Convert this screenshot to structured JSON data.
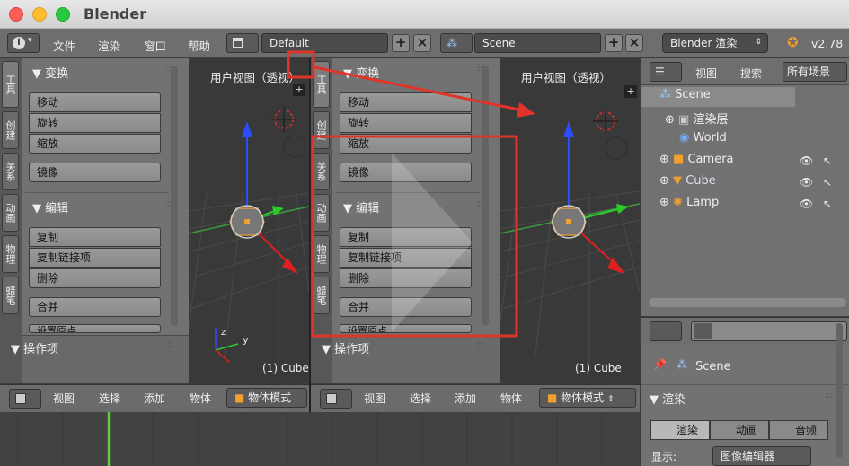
{
  "app": {
    "title": "Blender"
  },
  "infobar": {
    "menus": [
      "文件",
      "渲染",
      "窗口",
      "帮助"
    ],
    "layout": "Default",
    "scene": "Scene",
    "engine": "Blender 渲染",
    "version": "v2.78"
  },
  "left_panel": {
    "tabs": [
      "工具",
      "创建",
      "关系",
      "动画",
      "物理",
      "蜡笔"
    ],
    "transform_title": "▼ 变换",
    "transform_buttons": [
      "移动",
      "旋转",
      "缩放"
    ],
    "mirror": "镜像",
    "edit_title": "▼ 编辑",
    "edit_buttons": [
      "复制",
      "复制链接项",
      "删除"
    ],
    "join": "合并",
    "cut_label": "设置原点",
    "operator_title": "▼ 操作项"
  },
  "viewport": {
    "header": "用户视图（透视）",
    "object_label": "(1) Cube",
    "axis_y": "y",
    "axis_z": "z"
  },
  "toolbar": {
    "items": [
      "视图",
      "选择",
      "添加",
      "物体"
    ],
    "mode": "物体模式"
  },
  "outliner": {
    "menus": [
      "视图",
      "搜索"
    ],
    "filter": "所有场景",
    "rows": [
      "Scene",
      "渲染层",
      "World",
      "Camera",
      "Cube",
      "Lamp"
    ]
  },
  "properties": {
    "context_scene": "Scene",
    "section": "▼ 渲染",
    "tabs": [
      "渲染",
      "动画",
      "音频"
    ],
    "display_label": "显示:",
    "display_value": "图像编辑器"
  },
  "colors": {
    "accent": "#e0342a",
    "selection": "#f0a030"
  }
}
